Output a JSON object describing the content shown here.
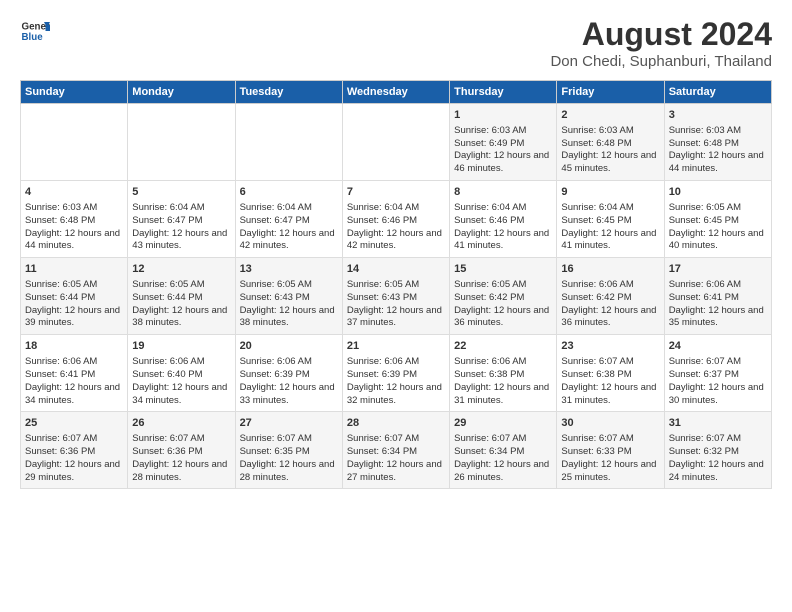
{
  "logo": {
    "line1": "General",
    "line2": "Blue"
  },
  "title": "August 2024",
  "subtitle": "Don Chedi, Suphanburi, Thailand",
  "days_of_week": [
    "Sunday",
    "Monday",
    "Tuesday",
    "Wednesday",
    "Thursday",
    "Friday",
    "Saturday"
  ],
  "weeks": [
    [
      {
        "day": "",
        "content": ""
      },
      {
        "day": "",
        "content": ""
      },
      {
        "day": "",
        "content": ""
      },
      {
        "day": "",
        "content": ""
      },
      {
        "day": "1",
        "content": "Sunrise: 6:03 AM\nSunset: 6:49 PM\nDaylight: 12 hours and 46 minutes."
      },
      {
        "day": "2",
        "content": "Sunrise: 6:03 AM\nSunset: 6:48 PM\nDaylight: 12 hours and 45 minutes."
      },
      {
        "day": "3",
        "content": "Sunrise: 6:03 AM\nSunset: 6:48 PM\nDaylight: 12 hours and 44 minutes."
      }
    ],
    [
      {
        "day": "4",
        "content": "Sunrise: 6:03 AM\nSunset: 6:48 PM\nDaylight: 12 hours and 44 minutes."
      },
      {
        "day": "5",
        "content": "Sunrise: 6:04 AM\nSunset: 6:47 PM\nDaylight: 12 hours and 43 minutes."
      },
      {
        "day": "6",
        "content": "Sunrise: 6:04 AM\nSunset: 6:47 PM\nDaylight: 12 hours and 42 minutes."
      },
      {
        "day": "7",
        "content": "Sunrise: 6:04 AM\nSunset: 6:46 PM\nDaylight: 12 hours and 42 minutes."
      },
      {
        "day": "8",
        "content": "Sunrise: 6:04 AM\nSunset: 6:46 PM\nDaylight: 12 hours and 41 minutes."
      },
      {
        "day": "9",
        "content": "Sunrise: 6:04 AM\nSunset: 6:45 PM\nDaylight: 12 hours and 41 minutes."
      },
      {
        "day": "10",
        "content": "Sunrise: 6:05 AM\nSunset: 6:45 PM\nDaylight: 12 hours and 40 minutes."
      }
    ],
    [
      {
        "day": "11",
        "content": "Sunrise: 6:05 AM\nSunset: 6:44 PM\nDaylight: 12 hours and 39 minutes."
      },
      {
        "day": "12",
        "content": "Sunrise: 6:05 AM\nSunset: 6:44 PM\nDaylight: 12 hours and 38 minutes."
      },
      {
        "day": "13",
        "content": "Sunrise: 6:05 AM\nSunset: 6:43 PM\nDaylight: 12 hours and 38 minutes."
      },
      {
        "day": "14",
        "content": "Sunrise: 6:05 AM\nSunset: 6:43 PM\nDaylight: 12 hours and 37 minutes."
      },
      {
        "day": "15",
        "content": "Sunrise: 6:05 AM\nSunset: 6:42 PM\nDaylight: 12 hours and 36 minutes."
      },
      {
        "day": "16",
        "content": "Sunrise: 6:06 AM\nSunset: 6:42 PM\nDaylight: 12 hours and 36 minutes."
      },
      {
        "day": "17",
        "content": "Sunrise: 6:06 AM\nSunset: 6:41 PM\nDaylight: 12 hours and 35 minutes."
      }
    ],
    [
      {
        "day": "18",
        "content": "Sunrise: 6:06 AM\nSunset: 6:41 PM\nDaylight: 12 hours and 34 minutes."
      },
      {
        "day": "19",
        "content": "Sunrise: 6:06 AM\nSunset: 6:40 PM\nDaylight: 12 hours and 34 minutes."
      },
      {
        "day": "20",
        "content": "Sunrise: 6:06 AM\nSunset: 6:39 PM\nDaylight: 12 hours and 33 minutes."
      },
      {
        "day": "21",
        "content": "Sunrise: 6:06 AM\nSunset: 6:39 PM\nDaylight: 12 hours and 32 minutes."
      },
      {
        "day": "22",
        "content": "Sunrise: 6:06 AM\nSunset: 6:38 PM\nDaylight: 12 hours and 31 minutes."
      },
      {
        "day": "23",
        "content": "Sunrise: 6:07 AM\nSunset: 6:38 PM\nDaylight: 12 hours and 31 minutes."
      },
      {
        "day": "24",
        "content": "Sunrise: 6:07 AM\nSunset: 6:37 PM\nDaylight: 12 hours and 30 minutes."
      }
    ],
    [
      {
        "day": "25",
        "content": "Sunrise: 6:07 AM\nSunset: 6:36 PM\nDaylight: 12 hours and 29 minutes."
      },
      {
        "day": "26",
        "content": "Sunrise: 6:07 AM\nSunset: 6:36 PM\nDaylight: 12 hours and 28 minutes."
      },
      {
        "day": "27",
        "content": "Sunrise: 6:07 AM\nSunset: 6:35 PM\nDaylight: 12 hours and 28 minutes."
      },
      {
        "day": "28",
        "content": "Sunrise: 6:07 AM\nSunset: 6:34 PM\nDaylight: 12 hours and 27 minutes."
      },
      {
        "day": "29",
        "content": "Sunrise: 6:07 AM\nSunset: 6:34 PM\nDaylight: 12 hours and 26 minutes."
      },
      {
        "day": "30",
        "content": "Sunrise: 6:07 AM\nSunset: 6:33 PM\nDaylight: 12 hours and 25 minutes."
      },
      {
        "day": "31",
        "content": "Sunrise: 6:07 AM\nSunset: 6:32 PM\nDaylight: 12 hours and 24 minutes."
      }
    ]
  ]
}
